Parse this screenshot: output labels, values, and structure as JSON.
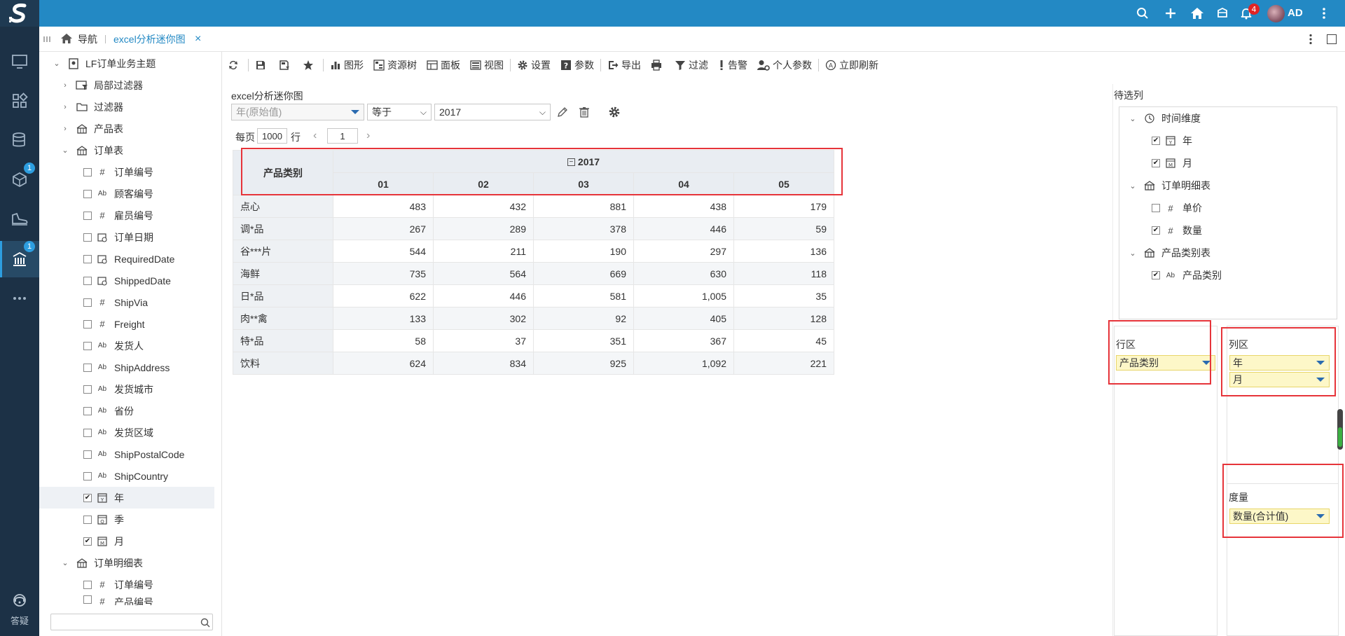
{
  "header": {
    "notify_count": "4",
    "user_initials": "AD"
  },
  "rail": {
    "badges": [
      "1",
      "1"
    ],
    "help_label": "答疑"
  },
  "breadcrumb": {
    "nav_label": "导航",
    "tab_label": "excel分析迷你图",
    "tab_close": "×"
  },
  "tree": {
    "root": "LF订单业务主题",
    "items": [
      "局部过滤器",
      "过滤器",
      "产品表",
      "订单表",
      "订单编号",
      "顾客编号",
      "雇员编号",
      "订单日期",
      "RequiredDate",
      "ShippedDate",
      "ShipVia",
      "Freight",
      "发货人",
      "ShipAddress",
      "发货城市",
      "省份",
      "发货区域",
      "ShipPostalCode",
      "ShipCountry",
      "年",
      "季",
      "月",
      "订单明细表",
      "订单编号",
      "产品编号"
    ]
  },
  "toolbar": {
    "chart": "图形",
    "resource_tree": "资源树",
    "panel": "面板",
    "view": "视图",
    "settings": "设置",
    "params": "参数",
    "export": "导出",
    "filter": "过滤",
    "alert": "告警",
    "personal_params": "个人参数",
    "refresh": "立即刷新"
  },
  "report": {
    "title": "excel分析迷你图",
    "filter_field": "年(原始值)",
    "filter_op": "等于",
    "filter_value": "2017",
    "per_page_label": "每页",
    "per_page_value": "1000",
    "rows_label": "行",
    "page_value": "1"
  },
  "pivot": {
    "row_header": "产品类别",
    "year": "2017",
    "months": [
      "01",
      "02",
      "03",
      "04",
      "05"
    ],
    "rows": [
      {
        "cat": "点心",
        "vals": [
          "483",
          "432",
          "881",
          "438",
          "179"
        ]
      },
      {
        "cat": "调*品",
        "vals": [
          "267",
          "289",
          "378",
          "446",
          "59"
        ]
      },
      {
        "cat": "谷***片",
        "vals": [
          "544",
          "211",
          "190",
          "297",
          "136"
        ]
      },
      {
        "cat": "海鲜",
        "vals": [
          "735",
          "564",
          "669",
          "630",
          "118"
        ]
      },
      {
        "cat": "日*品",
        "vals": [
          "622",
          "446",
          "581",
          "1,005",
          "35"
        ]
      },
      {
        "cat": "肉**禽",
        "vals": [
          "133",
          "302",
          "92",
          "405",
          "128"
        ]
      },
      {
        "cat": "特*品",
        "vals": [
          "58",
          "37",
          "351",
          "367",
          "45"
        ]
      },
      {
        "cat": "饮料",
        "vals": [
          "624",
          "834",
          "925",
          "1,092",
          "221"
        ]
      }
    ]
  },
  "panel": {
    "candidates_label": "待选列",
    "time_dim": "时间维度",
    "year": "年",
    "month": "月",
    "order_detail": "订单明细表",
    "unit_price": "单价",
    "quantity": "数量",
    "category_table": "产品类别表",
    "category": "产品类别",
    "row_zone_label": "行区",
    "row_field": "产品类别",
    "col_zone_label": "列区",
    "col_fields": [
      "年",
      "月"
    ],
    "measure_label": "度量",
    "measure_field": "数量(合计值)"
  }
}
